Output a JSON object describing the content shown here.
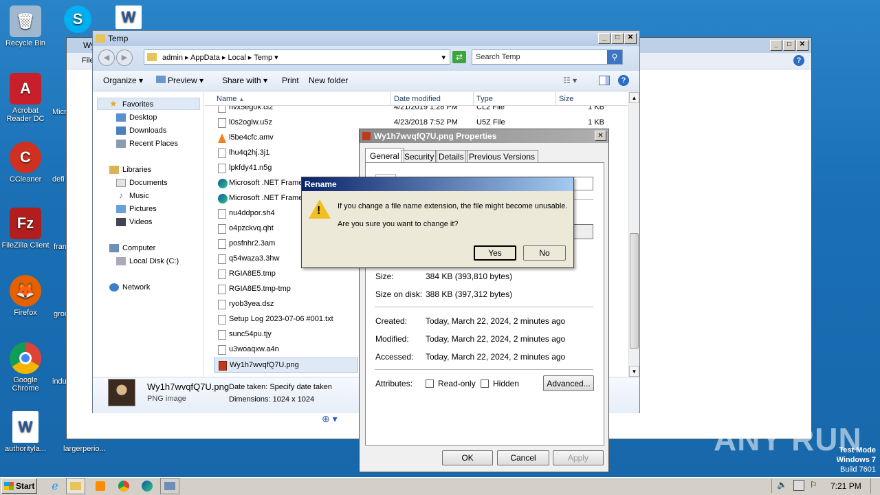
{
  "desktop_icons": [
    {
      "label": "Recycle Bin",
      "icon": "recycle-bin-icon",
      "color": "#9fb8d0"
    },
    {
      "label": "Acrobat Reader DC",
      "icon": "acrobat-icon",
      "color": "#c8202a"
    },
    {
      "label": "CCleaner",
      "icon": "ccleaner-icon",
      "color": "#d03020"
    },
    {
      "label": "FileZilla Client",
      "icon": "filezilla-icon",
      "color": "#b21e1e"
    },
    {
      "label": "Firefox",
      "icon": "firefox-icon",
      "color": "#e66000"
    },
    {
      "label": "Google Chrome",
      "icon": "chrome-icon",
      "color": "#2a9d3c"
    },
    {
      "label": "authorityla...",
      "icon": "word-doc-icon",
      "color": "#2b5797"
    }
  ],
  "desktop_icons_col2": [
    "Micr",
    "defi",
    "fran",
    "grou",
    "indu",
    "largerperio..."
  ],
  "bg_window": {
    "menu_item": "File",
    "title": "Wy"
  },
  "explorer": {
    "title": "Temp",
    "breadcrumb": [
      "admin",
      "AppData",
      "Local",
      "Temp"
    ],
    "search_placeholder": "Search Temp",
    "toolbar": {
      "organize": "Organize",
      "preview": "Preview",
      "share_with": "Share with",
      "print": "Print",
      "new_folder": "New folder"
    },
    "columns": {
      "name": "Name",
      "date_modified": "Date modified",
      "type": "Type",
      "size": "Size"
    },
    "nav": {
      "favorites": "Favorites",
      "desktop": "Desktop",
      "downloads": "Downloads",
      "recent_places": "Recent Places",
      "libraries": "Libraries",
      "documents": "Documents",
      "music": "Music",
      "pictures": "Pictures",
      "videos": "Videos",
      "computer": "Computer",
      "local_disk": "Local Disk (C:)",
      "network": "Network"
    },
    "files": [
      {
        "name": "hvx5eg0k.cl2",
        "date": "4/21/2019 1:28 PM",
        "type": "CL2 File",
        "size": "1 KB"
      },
      {
        "name": "l0s2oglw.u5z",
        "date": "4/23/2018 7:52 PM",
        "type": "U5Z File",
        "size": "1 KB"
      },
      {
        "name": "l5be4cfc.amv",
        "date": "",
        "type": "",
        "size": ""
      },
      {
        "name": "lhu4q2hj.3j1",
        "date": "",
        "type": "",
        "size": ""
      },
      {
        "name": "lpkfdy41.n5g",
        "date": "",
        "type": "",
        "size": ""
      },
      {
        "name": "Microsoft .NET Frame",
        "date": "",
        "type": "",
        "size": ""
      },
      {
        "name": "Microsoft .NET Frame",
        "date": "",
        "type": "",
        "size": ""
      },
      {
        "name": "nu4ddpor.sh4",
        "date": "",
        "type": "",
        "size": ""
      },
      {
        "name": "o4pzckvq.qht",
        "date": "",
        "type": "",
        "size": ""
      },
      {
        "name": "posfnhr2.3am",
        "date": "",
        "type": "",
        "size": ""
      },
      {
        "name": "q54waza3.3hw",
        "date": "",
        "type": "",
        "size": ""
      },
      {
        "name": "RGIA8E5.tmp",
        "date": "",
        "type": "",
        "size": ""
      },
      {
        "name": "RGIA8E5.tmp-tmp",
        "date": "",
        "type": "",
        "size": ""
      },
      {
        "name": "ryob3yea.dsz",
        "date": "",
        "type": "",
        "size": ""
      },
      {
        "name": "Setup Log 2023-07-06 #001.txt",
        "date": "",
        "type": "",
        "size": ""
      },
      {
        "name": "sunc54pu.tjy",
        "date": "",
        "type": "",
        "size": ""
      },
      {
        "name": "u3woaqxw.a4n",
        "date": "",
        "type": "",
        "size": ""
      },
      {
        "name": "Wy1h7wvqfQ7U.png",
        "date": "",
        "type": "",
        "size": ""
      }
    ],
    "details": {
      "filename": "Wy1h7wvqfQ7U.png",
      "filetype": "PNG image",
      "date_taken": "Date taken: Specify date taken",
      "dimensions": "Dimensions: 1024 x 1024"
    }
  },
  "properties": {
    "title": "Wy1h7wvqfQ7U.png Properties",
    "tabs": [
      "General",
      "Security",
      "Details",
      "Previous Versions"
    ],
    "size_label": "Size:",
    "size_value": "384 KB (393,810 bytes)",
    "size_on_disk_label": "Size on disk:",
    "size_on_disk_value": "388 KB (397,312 bytes)",
    "created_label": "Created:",
    "created_value": "Today, March 22, 2024, 2 minutes ago",
    "modified_label": "Modified:",
    "modified_value": "Today, March 22, 2024, 2 minutes ago",
    "accessed_label": "Accessed:",
    "accessed_value": "Today, March 22, 2024, 2 minutes ago",
    "attributes_label": "Attributes:",
    "readonly": "Read-only",
    "hidden": "Hidden",
    "advanced": "Advanced...",
    "ok": "OK",
    "cancel": "Cancel",
    "apply": "Apply"
  },
  "rename": {
    "title": "Rename",
    "line1": "If you change a file name extension, the file might become unusable.",
    "line2": "Are you sure you want to change it?",
    "yes": "Yes",
    "no": "No"
  },
  "taskbar": {
    "start": "Start",
    "time": "7:21 PM"
  },
  "watermark": {
    "brand": "ANY RUN",
    "line1": "Test Mode",
    "line2": "Windows 7",
    "line3": "Build 7601"
  }
}
